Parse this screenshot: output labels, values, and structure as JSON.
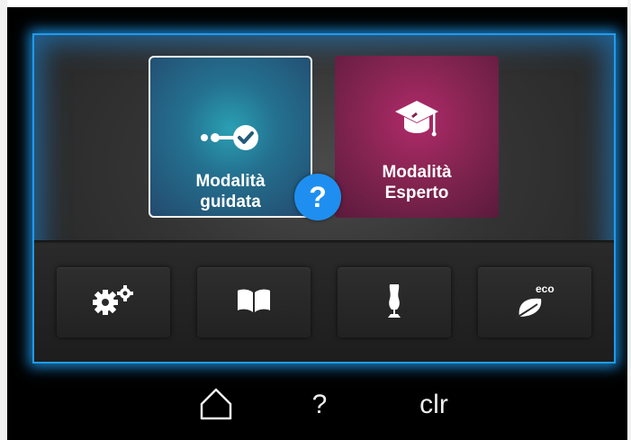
{
  "modes": {
    "guided": {
      "label": "Modalità\nguidata",
      "icon": "guided-steps-icon"
    },
    "expert": {
      "label": "Modalità\nEsperto",
      "icon": "graduation-cap-icon"
    }
  },
  "help_bubble": {
    "label": "?"
  },
  "functions": [
    {
      "name": "settings",
      "icon": "gears-icon"
    },
    {
      "name": "tutorial",
      "icon": "book-icon"
    },
    {
      "name": "sewing",
      "icon": "dress-form-icon"
    },
    {
      "name": "eco",
      "icon": "eco-leaf-icon",
      "badge": "eco"
    }
  ],
  "nav": {
    "home_icon": "home-icon",
    "help_label": "?",
    "clear_label": "clr"
  },
  "colors": {
    "screen_border": "#1e9bf0",
    "help_bubble": "#1e8ff0",
    "guided_tile": "#24708f",
    "expert_tile": "#82244f"
  }
}
